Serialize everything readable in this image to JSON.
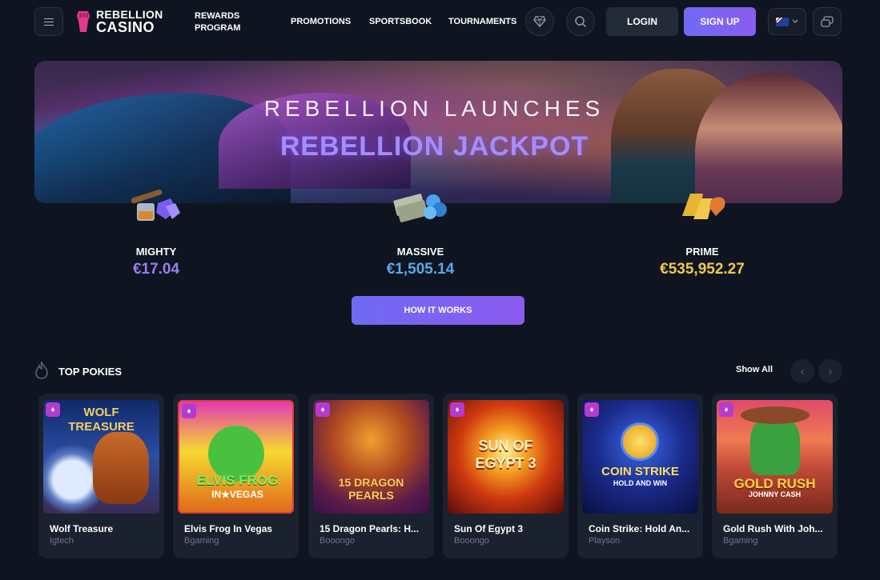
{
  "header": {
    "logo_line1": "REBELLION",
    "logo_line2": "CASINO",
    "rewards_label": "REWARDS PROGRAM",
    "nav": [
      "PROMOTIONS",
      "SPORTSBOOK",
      "TOURNAMENTS"
    ],
    "login_label": "LOGIN",
    "signup_label": "SIGN UP",
    "icons": {
      "menu": "hamburger-icon",
      "diamond": "diamond-icon",
      "search": "search-icon",
      "language": "australia-flag-icon",
      "chevron": "chevron-down-icon",
      "chat": "chat-icon"
    }
  },
  "banner": {
    "title_line1": "REBELLION LAUNCHES",
    "title_line2": "REBELLION JACKPOT"
  },
  "jackpots": [
    {
      "label": "MIGHTY",
      "value": "€17.04",
      "color": "#9a7cf0",
      "icon": "cigar-gems-icon"
    },
    {
      "label": "MASSIVE",
      "value": "€1,505.14",
      "color": "#59a9e8",
      "icon": "cash-stack-icon"
    },
    {
      "label": "PRIME",
      "value": "€535,952.27",
      "color": "#f0c94a",
      "icon": "gold-bars-icon"
    }
  ],
  "how_it_works_label": "HOW IT WORKS",
  "top_pokies": {
    "title": "TOP POKIES",
    "show_all": "Show All",
    "prev_icon": "chevron-left-icon",
    "next_icon": "chevron-right-icon",
    "games": [
      {
        "name": "Wolf Treasure",
        "provider": "Igtech",
        "logo1": "WOLF",
        "logo2": "TREASURE"
      },
      {
        "name": "Elvis Frog In Vegas",
        "provider": "Bgaming",
        "logo1": "ELVIS FROG",
        "logo2": "IN★VEGAS"
      },
      {
        "name": "15 Dragon Pearls: H...",
        "provider": "Booongo",
        "logo1": "15 DRAGON",
        "logo2": "PEARLS"
      },
      {
        "name": "Sun Of Egypt 3",
        "provider": "Booongo",
        "logo1": "SUN OF",
        "logo2": "EGYPT 3"
      },
      {
        "name": "Coin Strike: Hold An...",
        "provider": "Playson",
        "logo1": "COIN STRIKE",
        "logo2": "HOLD AND WIN"
      },
      {
        "name": "Gold Rush With Joh...",
        "provider": "Bgaming",
        "logo1": "GOLD RUSH",
        "logo2": "JOHNNY CASH"
      }
    ]
  }
}
